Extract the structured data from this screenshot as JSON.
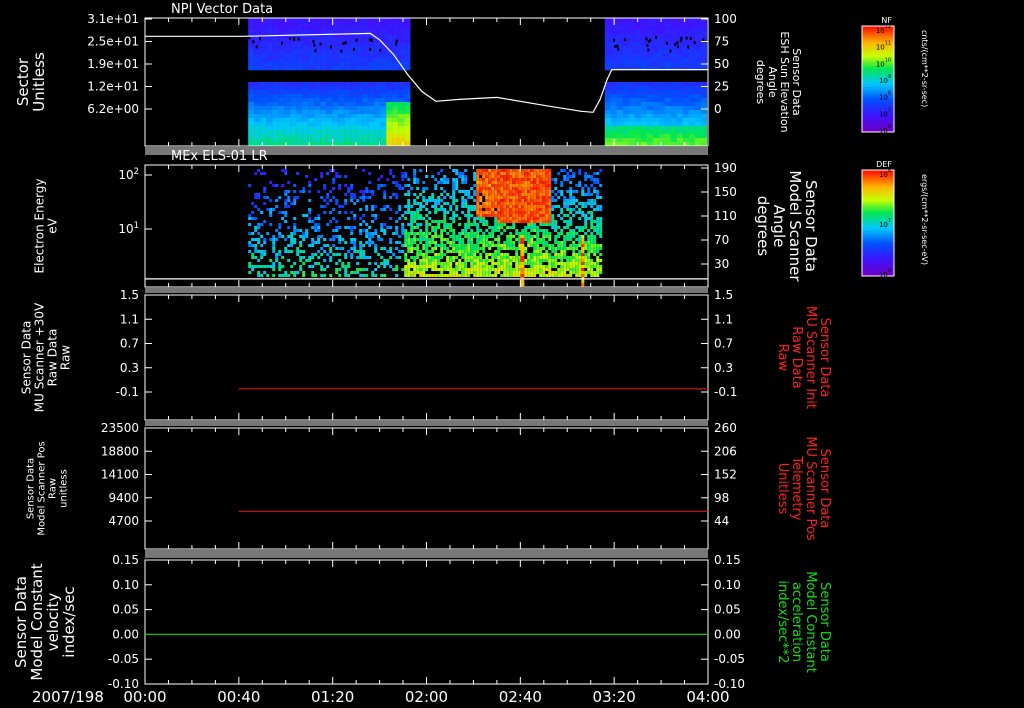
{
  "time_axis": {
    "date": "2007/198",
    "ticks": [
      "00:00",
      "00:40",
      "01:20",
      "02:00",
      "02:40",
      "03:20",
      "04:00"
    ],
    "range_minutes": [
      0,
      240
    ]
  },
  "chart_data": [
    {
      "type": "heatmap",
      "title": "NPI Vector Data",
      "ylabel_lines": [
        "Sector",
        "Unitless"
      ],
      "yticks": [
        "3.1e+01",
        "2.5e+01",
        "1.9e+01",
        "1.2e+01",
        "6.2e+00"
      ],
      "ylim": [
        0,
        32
      ],
      "right_axis": {
        "label_lines": [
          "Sensor Data",
          "ESH Sun Elevation",
          "Angle",
          "degrees"
        ],
        "ticks": [
          "100",
          "75",
          "50",
          "25",
          "0"
        ],
        "ylim": [
          -25,
          100
        ]
      },
      "coverage_minutes": [
        [
          44,
          114
        ],
        [
          196,
          240
        ]
      ],
      "series": [
        {
          "color": "#ffffff",
          "x_minutes": [
            0,
            42,
            96,
            100,
            106,
            112,
            118,
            124,
            134,
            150,
            170,
            186,
            191,
            194,
            197,
            199,
            240
          ],
          "y_degrees": [
            83.6,
            83.6,
            86.5,
            80,
            65,
            45,
            28,
            18,
            20,
            22,
            14,
            8,
            7,
            20,
            40,
            50,
            50
          ]
        }
      ],
      "colorbar": {
        "label": "NF",
        "units": "cnts/(cm**2-sr-sec)",
        "ticks": [
          "10^12",
          "10^11",
          "10^10",
          "10^9",
          "10^8",
          "10^7",
          "10^6"
        ]
      }
    },
    {
      "type": "heatmap",
      "title": "MEx ELS-01 LR",
      "ylabel_lines": [
        "Electron Energy",
        "eV"
      ],
      "yticks": [
        "10^2",
        "10^1"
      ],
      "yscale": "log",
      "ylim": [
        1.5,
        180
      ],
      "right_axis": {
        "label_lines": [
          "Sensor Data",
          "Model Scanner",
          "Angle",
          "degrees"
        ],
        "ticks": [
          "190",
          "150",
          "110",
          "70",
          "30"
        ],
        "ylim": [
          0,
          190
        ]
      },
      "coverage_minutes": [
        [
          44,
          194
        ]
      ],
      "series": [
        {
          "color": "#ffffff",
          "x_minutes": [
            0,
            240
          ],
          "y_degrees": [
            10,
            10
          ]
        }
      ],
      "colorbar": {
        "label": "DEF",
        "units": "ergs/(cm**2-sr-sec-eV)",
        "ticks": [
          "10^8",
          "10^7",
          "10^6"
        ]
      }
    },
    {
      "type": "line",
      "ylabel_lines": [
        "Sensor Data",
        "MU Scanner +30V",
        "Raw Data",
        "Raw"
      ],
      "yticks": [
        "1.5",
        "1.1",
        "0.7",
        "0.3",
        "-0.1"
      ],
      "ylim": [
        -0.5,
        1.5
      ],
      "right_axis": {
        "label_lines": [
          "Sensor Data",
          "MU Scanner Init",
          "Raw Data",
          "Raw"
        ],
        "label_color": "#ff2020",
        "ticks": [
          "1.5",
          "1.1",
          "0.7",
          "0.3",
          "-0.1"
        ],
        "ylim": [
          -0.5,
          1.5
        ]
      },
      "series": [
        {
          "color": "#d01818",
          "axis": "right",
          "x_minutes": [
            40,
            240
          ],
          "y": [
            0.0,
            0.0
          ]
        }
      ]
    },
    {
      "type": "line",
      "ylabel_lines": [
        "Sensor Data",
        "Model Scanner Pos",
        "Raw",
        "unitless"
      ],
      "yticks": [
        "23500",
        "18800",
        "14100",
        "9400",
        "4700"
      ],
      "ylim": [
        0,
        23500
      ],
      "right_axis": {
        "label_lines": [
          "Sensor Data",
          "MU Scanner Pos",
          "Telemetry",
          "Unitless"
        ],
        "label_color": "#ff2020",
        "ticks": [
          "260",
          "206",
          "152",
          "98",
          "44"
        ],
        "ylim": [
          0,
          260
        ]
      },
      "series": [
        {
          "color": "#d01818",
          "axis": "right",
          "x_minutes": [
            40,
            240
          ],
          "y": [
            81,
            81
          ]
        }
      ]
    },
    {
      "type": "line",
      "ylabel_lines": [
        "Sensor Data",
        "Model Constant",
        "velocity",
        "index/sec"
      ],
      "yticks": [
        "0.15",
        "0.10",
        "0.05",
        "0.00",
        "-0.05",
        "-0.10"
      ],
      "ylim": [
        -0.1,
        0.15
      ],
      "right_axis": {
        "label_lines": [
          "Sensor Data",
          "Model Constant",
          "acceleration",
          "index/sec**2"
        ],
        "label_color": "#10e010",
        "ticks": [
          "0.15",
          "0.10",
          "0.05",
          "0.00",
          "-0.05",
          "-0.10"
        ],
        "ylim": [
          -0.1,
          0.15
        ]
      },
      "series": [
        {
          "color": "#10c010",
          "axis": "left",
          "x_minutes": [
            0,
            240
          ],
          "y": [
            0.0,
            0.0
          ]
        }
      ]
    }
  ]
}
